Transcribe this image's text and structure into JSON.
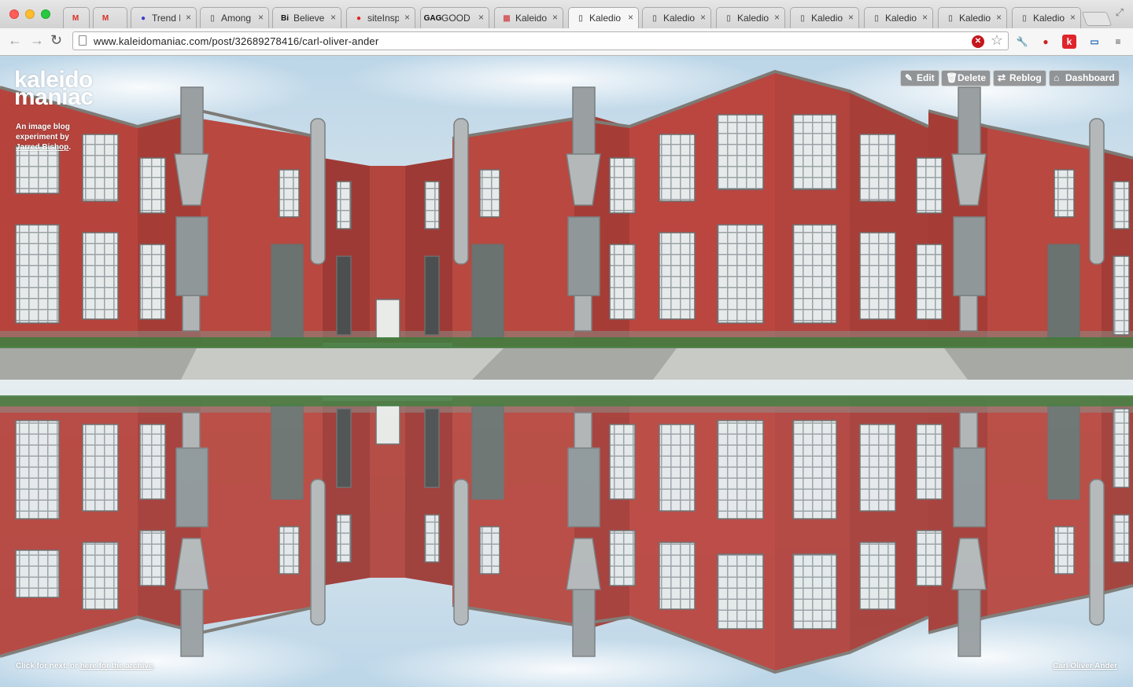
{
  "browser": {
    "tabs": [
      {
        "title": "",
        "icon": "gmail-icon",
        "glyph": "M",
        "color": "#d93025",
        "closable": false
      },
      {
        "title": "",
        "icon": "gmail-icon",
        "glyph": "M",
        "color": "#d93025",
        "closable": false
      },
      {
        "title": "Trend L",
        "icon": "dot-icon",
        "glyph": "●",
        "color": "#3b3bd1",
        "closable": true
      },
      {
        "title": "Among",
        "icon": "page-icon",
        "glyph": "▯",
        "color": "#777777",
        "closable": true
      },
      {
        "title": "Believe",
        "icon": "bi-icon",
        "glyph": "Bi",
        "color": "#111111",
        "closable": true
      },
      {
        "title": "siteInsp",
        "icon": "red-circle-icon",
        "glyph": "●",
        "color": "#e52020",
        "closable": true
      },
      {
        "title": "GOOD /",
        "icon": "gag-icon",
        "glyph": "GAG",
        "color": "#111111",
        "closable": true
      },
      {
        "title": "Kaleido",
        "icon": "kaleido-thumb-icon",
        "glyph": "▦",
        "color": "#d2585c",
        "closable": true
      },
      {
        "title": "Kaledio",
        "icon": "page-icon",
        "glyph": "▯",
        "color": "#777777",
        "closable": true,
        "active": true
      },
      {
        "title": "Kaledio",
        "icon": "page-icon",
        "glyph": "▯",
        "color": "#777777",
        "closable": true
      },
      {
        "title": "Kaledio",
        "icon": "page-icon",
        "glyph": "▯",
        "color": "#777777",
        "closable": true
      },
      {
        "title": "Kaledio",
        "icon": "page-icon",
        "glyph": "▯",
        "color": "#777777",
        "closable": true
      },
      {
        "title": "Kaledio",
        "icon": "page-icon",
        "glyph": "▯",
        "color": "#777777",
        "closable": true
      },
      {
        "title": "Kaledio",
        "icon": "page-icon",
        "glyph": "▯",
        "color": "#777777",
        "closable": true
      },
      {
        "title": "Kaledio",
        "icon": "page-icon",
        "glyph": "▯",
        "color": "#777777",
        "closable": true
      }
    ],
    "close_glyph": "×",
    "url": "www.kaleidomaniac.com/post/32689278416/carl-oliver-ander",
    "nav": {
      "back": "←",
      "forward": "→",
      "reload": "↻"
    },
    "extensions": [
      {
        "name": "wrench-icon",
        "glyph": "🔧"
      },
      {
        "name": "lastpass-icon",
        "glyph": "●"
      },
      {
        "name": "klout-icon",
        "glyph": "k"
      },
      {
        "name": "screen-capture-icon",
        "glyph": "▭"
      },
      {
        "name": "menu-icon",
        "glyph": "≡"
      }
    ]
  },
  "blog": {
    "logo_line1": "kaleido",
    "logo_line2": "maniac",
    "tagline_prefix": "An image blog experiment by",
    "tagline_author": "Jarred Bishop",
    "tagline_suffix": ".",
    "controls": [
      {
        "label": "Edit",
        "icon": "edit-icon",
        "glyph": "✎"
      },
      {
        "label": "Delete",
        "icon": "trash-icon",
        "glyph": "🗑"
      },
      {
        "label": "Reblog",
        "icon": "reblog-icon",
        "glyph": "⇄"
      },
      {
        "label": "Dashboard",
        "icon": "home-icon",
        "glyph": "⌂"
      }
    ],
    "footer_prefix": "Click for next, or",
    "footer_link": "here for the archive",
    "footer_suffix": ".",
    "credit": "Carl Oliver Ander"
  },
  "colors": {
    "brick": "#b8433d",
    "brick_dark": "#8e302c",
    "sky": "#cfe2ef",
    "window": "#eef2f3",
    "ground": "#a8aaa6"
  }
}
